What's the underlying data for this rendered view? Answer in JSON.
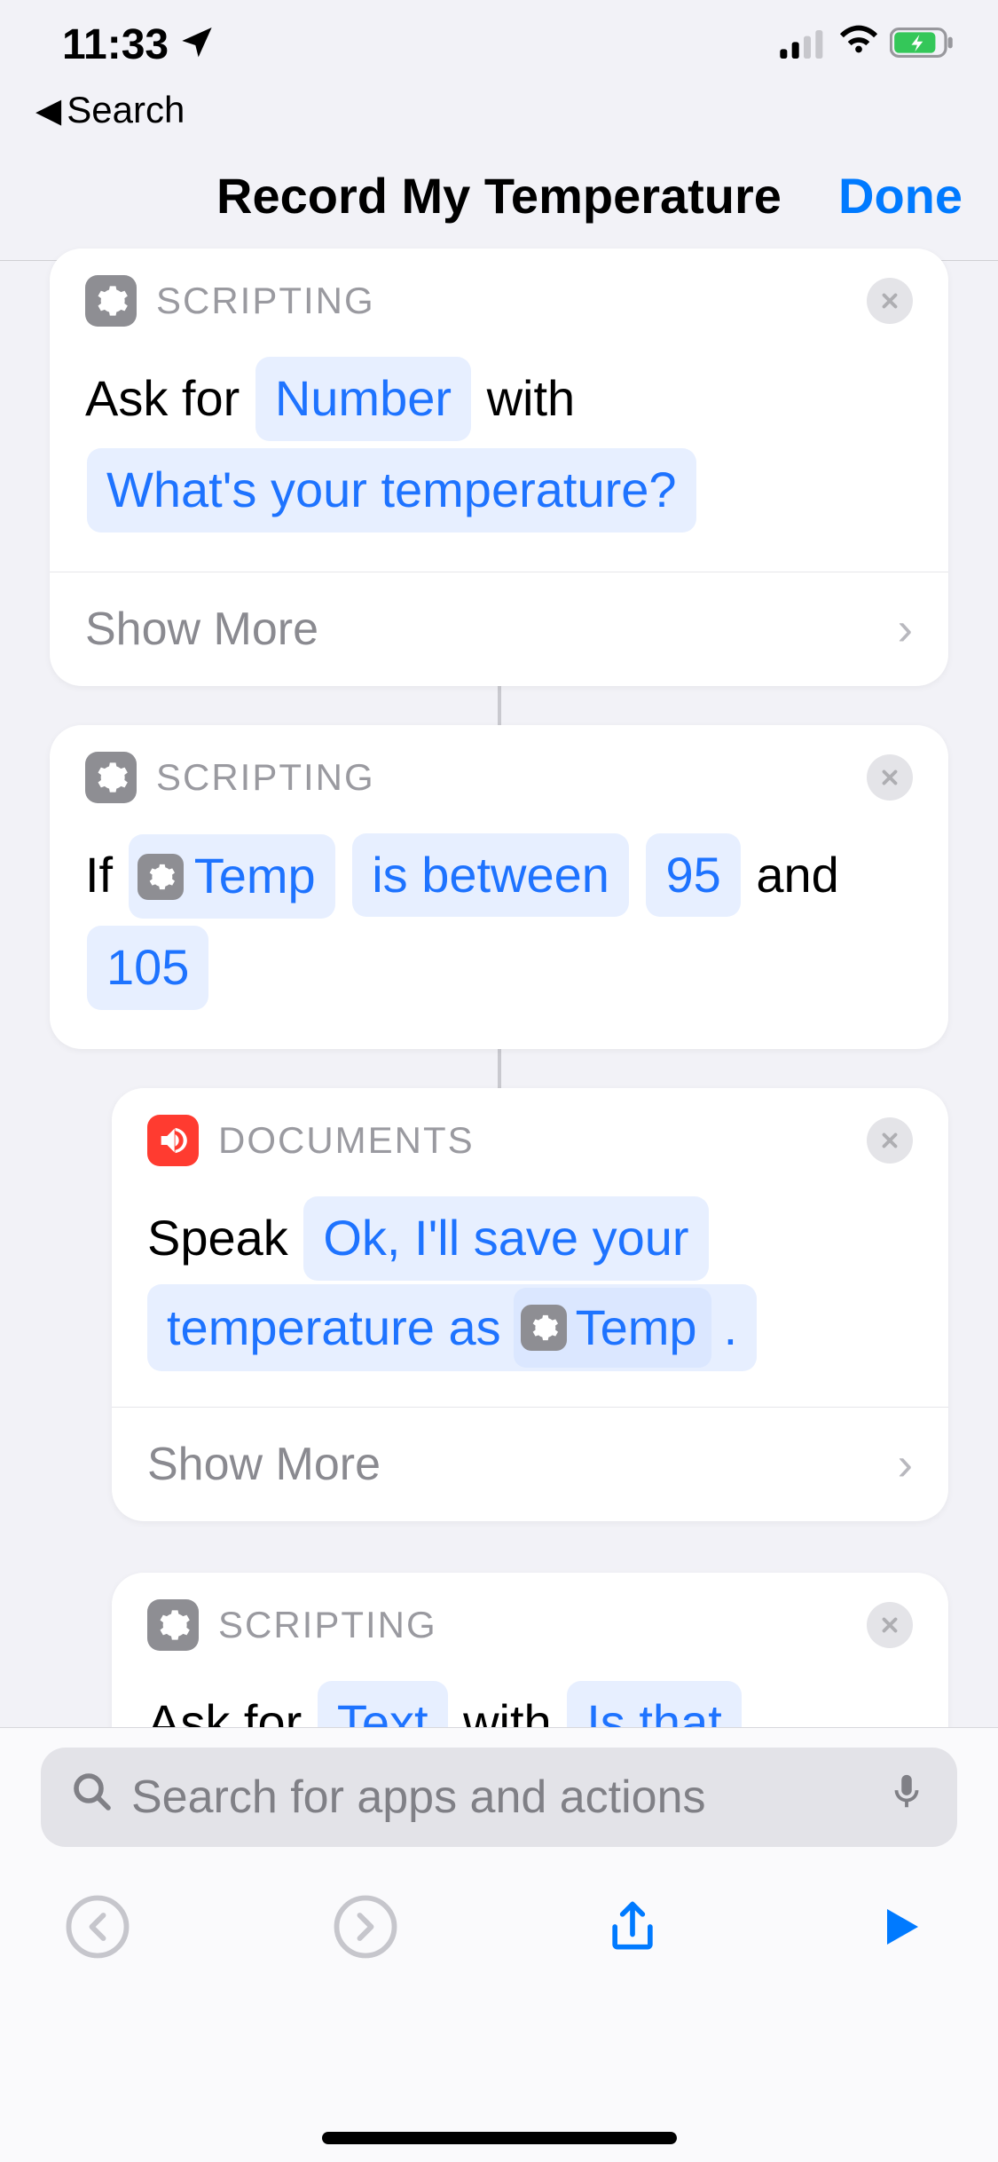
{
  "status": {
    "time": "11:33",
    "back_label": "Search"
  },
  "nav": {
    "title": "Record My Temperature",
    "done": "Done"
  },
  "card1": {
    "category": "SCRIPTING",
    "prefix": "Ask for",
    "type_token": "Number",
    "with": "with",
    "prompt_token": "What's your temperature?",
    "show_more": "Show More"
  },
  "card2": {
    "category": "SCRIPTING",
    "if": "If",
    "var_name": "Temp",
    "condition": "is between",
    "low": "95",
    "and": "and",
    "high": "105"
  },
  "card3": {
    "category": "DOCUMENTS",
    "verb": "Speak",
    "line1": "Ok, I'll save your",
    "line2a": "temperature as",
    "var_name": "Temp",
    "line2b": ".",
    "show_more": "Show More"
  },
  "card4": {
    "category": "SCRIPTING",
    "prefix": "Ask for",
    "type_token": "Text",
    "with": "with",
    "prompt_start": "Is that"
  },
  "search": {
    "placeholder": "Search for apps and actions"
  }
}
